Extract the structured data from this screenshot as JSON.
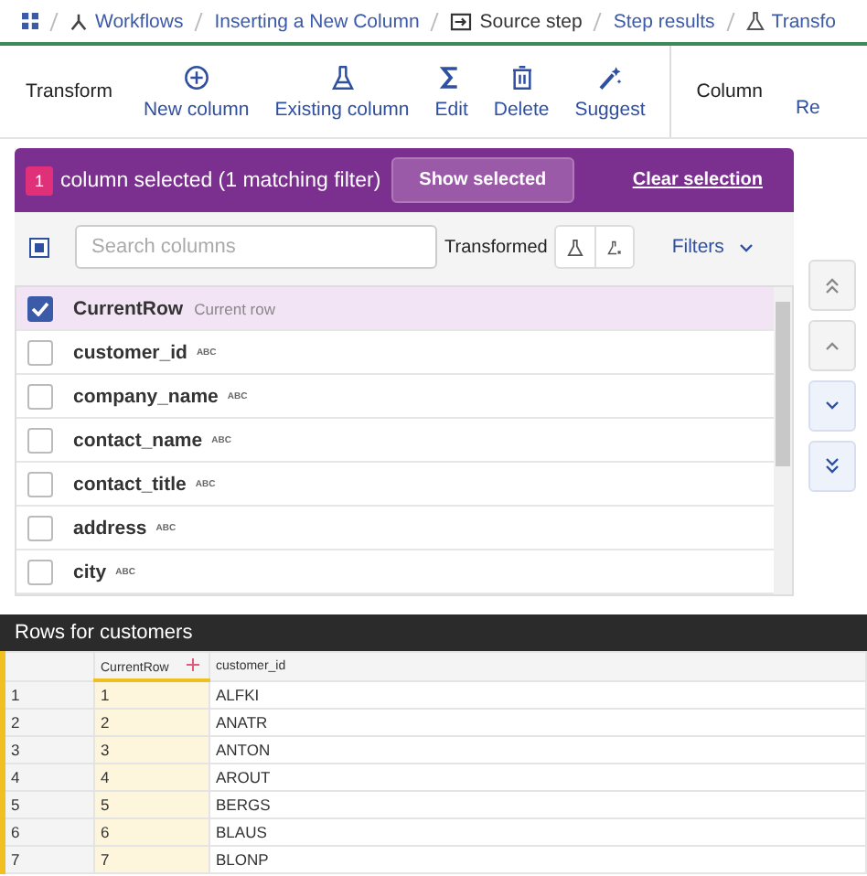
{
  "breadcrumb": [
    {
      "label": "Workflows"
    },
    {
      "label": "Inserting a New Column"
    },
    {
      "label": "Source step"
    },
    {
      "label": "Step results"
    },
    {
      "label": "Transfo"
    }
  ],
  "toolbar": {
    "group_label": "Transform",
    "buttons": [
      {
        "label": "New column"
      },
      {
        "label": "Existing column"
      },
      {
        "label": "Edit"
      },
      {
        "label": "Delete"
      },
      {
        "label": "Suggest"
      }
    ],
    "group2_label": "Column",
    "cut_label": "Re"
  },
  "selection_bar": {
    "count": "1",
    "text": "column selected (1 matching filter)",
    "show_button": "Show selected",
    "clear_link": "Clear selection"
  },
  "filter_row": {
    "select_all_checked": true,
    "search_placeholder": "Search columns",
    "transformed_label": "Transformed",
    "filters_label": "Filters"
  },
  "columns": [
    {
      "name": "CurrentRow",
      "note": "Current row",
      "checked": true
    },
    {
      "name": "customer_id",
      "type": "ABC",
      "checked": false
    },
    {
      "name": "company_name",
      "type": "ABC",
      "checked": false
    },
    {
      "name": "contact_name",
      "type": "ABC",
      "checked": false
    },
    {
      "name": "contact_title",
      "type": "ABC",
      "checked": false
    },
    {
      "name": "address",
      "type": "ABC",
      "checked": false
    },
    {
      "name": "city",
      "type": "ABC",
      "checked": false
    }
  ],
  "rows_panel": {
    "title": "Rows for customers",
    "headers": [
      "CurrentRow",
      "customer_id"
    ],
    "rows": [
      [
        "1",
        "1",
        "ALFKI"
      ],
      [
        "2",
        "2",
        "ANATR"
      ],
      [
        "3",
        "3",
        "ANTON"
      ],
      [
        "4",
        "4",
        "AROUT"
      ],
      [
        "5",
        "5",
        "BERGS"
      ],
      [
        "6",
        "6",
        "BLAUS"
      ],
      [
        "7",
        "7",
        "BLONP"
      ]
    ]
  }
}
